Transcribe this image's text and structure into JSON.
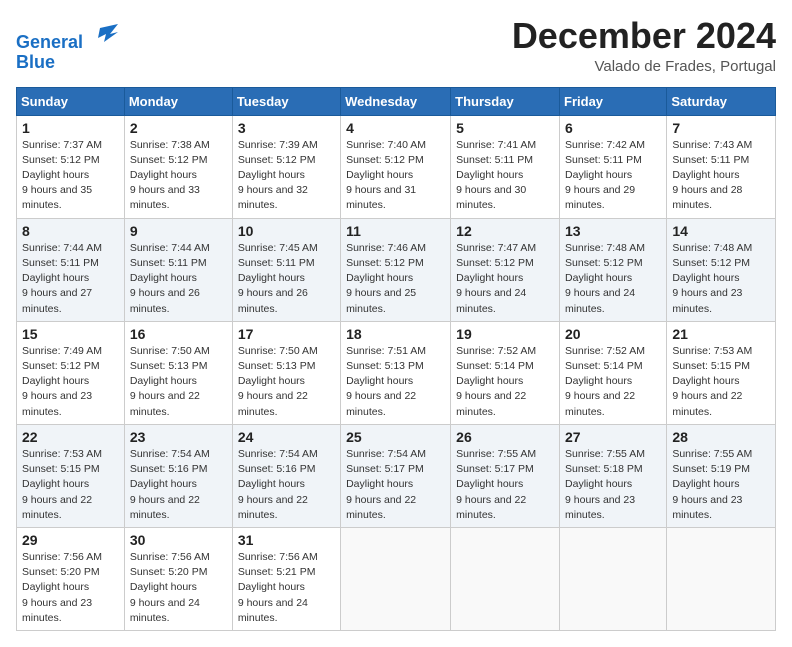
{
  "header": {
    "logo_line1": "General",
    "logo_line2": "Blue",
    "month_title": "December 2024",
    "location": "Valado de Frades, Portugal"
  },
  "weekdays": [
    "Sunday",
    "Monday",
    "Tuesday",
    "Wednesday",
    "Thursday",
    "Friday",
    "Saturday"
  ],
  "weeks": [
    [
      {
        "day": "1",
        "sunrise": "7:37 AM",
        "sunset": "5:12 PM",
        "daylight": "9 hours and 35 minutes."
      },
      {
        "day": "2",
        "sunrise": "7:38 AM",
        "sunset": "5:12 PM",
        "daylight": "9 hours and 33 minutes."
      },
      {
        "day": "3",
        "sunrise": "7:39 AM",
        "sunset": "5:12 PM",
        "daylight": "9 hours and 32 minutes."
      },
      {
        "day": "4",
        "sunrise": "7:40 AM",
        "sunset": "5:12 PM",
        "daylight": "9 hours and 31 minutes."
      },
      {
        "day": "5",
        "sunrise": "7:41 AM",
        "sunset": "5:11 PM",
        "daylight": "9 hours and 30 minutes."
      },
      {
        "day": "6",
        "sunrise": "7:42 AM",
        "sunset": "5:11 PM",
        "daylight": "9 hours and 29 minutes."
      },
      {
        "day": "7",
        "sunrise": "7:43 AM",
        "sunset": "5:11 PM",
        "daylight": "9 hours and 28 minutes."
      }
    ],
    [
      {
        "day": "8",
        "sunrise": "7:44 AM",
        "sunset": "5:11 PM",
        "daylight": "9 hours and 27 minutes."
      },
      {
        "day": "9",
        "sunrise": "7:44 AM",
        "sunset": "5:11 PM",
        "daylight": "9 hours and 26 minutes."
      },
      {
        "day": "10",
        "sunrise": "7:45 AM",
        "sunset": "5:11 PM",
        "daylight": "9 hours and 26 minutes."
      },
      {
        "day": "11",
        "sunrise": "7:46 AM",
        "sunset": "5:12 PM",
        "daylight": "9 hours and 25 minutes."
      },
      {
        "day": "12",
        "sunrise": "7:47 AM",
        "sunset": "5:12 PM",
        "daylight": "9 hours and 24 minutes."
      },
      {
        "day": "13",
        "sunrise": "7:48 AM",
        "sunset": "5:12 PM",
        "daylight": "9 hours and 24 minutes."
      },
      {
        "day": "14",
        "sunrise": "7:48 AM",
        "sunset": "5:12 PM",
        "daylight": "9 hours and 23 minutes."
      }
    ],
    [
      {
        "day": "15",
        "sunrise": "7:49 AM",
        "sunset": "5:12 PM",
        "daylight": "9 hours and 23 minutes."
      },
      {
        "day": "16",
        "sunrise": "7:50 AM",
        "sunset": "5:13 PM",
        "daylight": "9 hours and 22 minutes."
      },
      {
        "day": "17",
        "sunrise": "7:50 AM",
        "sunset": "5:13 PM",
        "daylight": "9 hours and 22 minutes."
      },
      {
        "day": "18",
        "sunrise": "7:51 AM",
        "sunset": "5:13 PM",
        "daylight": "9 hours and 22 minutes."
      },
      {
        "day": "19",
        "sunrise": "7:52 AM",
        "sunset": "5:14 PM",
        "daylight": "9 hours and 22 minutes."
      },
      {
        "day": "20",
        "sunrise": "7:52 AM",
        "sunset": "5:14 PM",
        "daylight": "9 hours and 22 minutes."
      },
      {
        "day": "21",
        "sunrise": "7:53 AM",
        "sunset": "5:15 PM",
        "daylight": "9 hours and 22 minutes."
      }
    ],
    [
      {
        "day": "22",
        "sunrise": "7:53 AM",
        "sunset": "5:15 PM",
        "daylight": "9 hours and 22 minutes."
      },
      {
        "day": "23",
        "sunrise": "7:54 AM",
        "sunset": "5:16 PM",
        "daylight": "9 hours and 22 minutes."
      },
      {
        "day": "24",
        "sunrise": "7:54 AM",
        "sunset": "5:16 PM",
        "daylight": "9 hours and 22 minutes."
      },
      {
        "day": "25",
        "sunrise": "7:54 AM",
        "sunset": "5:17 PM",
        "daylight": "9 hours and 22 minutes."
      },
      {
        "day": "26",
        "sunrise": "7:55 AM",
        "sunset": "5:17 PM",
        "daylight": "9 hours and 22 minutes."
      },
      {
        "day": "27",
        "sunrise": "7:55 AM",
        "sunset": "5:18 PM",
        "daylight": "9 hours and 23 minutes."
      },
      {
        "day": "28",
        "sunrise": "7:55 AM",
        "sunset": "5:19 PM",
        "daylight": "9 hours and 23 minutes."
      }
    ],
    [
      {
        "day": "29",
        "sunrise": "7:56 AM",
        "sunset": "5:20 PM",
        "daylight": "9 hours and 23 minutes."
      },
      {
        "day": "30",
        "sunrise": "7:56 AM",
        "sunset": "5:20 PM",
        "daylight": "9 hours and 24 minutes."
      },
      {
        "day": "31",
        "sunrise": "7:56 AM",
        "sunset": "5:21 PM",
        "daylight": "9 hours and 24 minutes."
      },
      null,
      null,
      null,
      null
    ]
  ]
}
